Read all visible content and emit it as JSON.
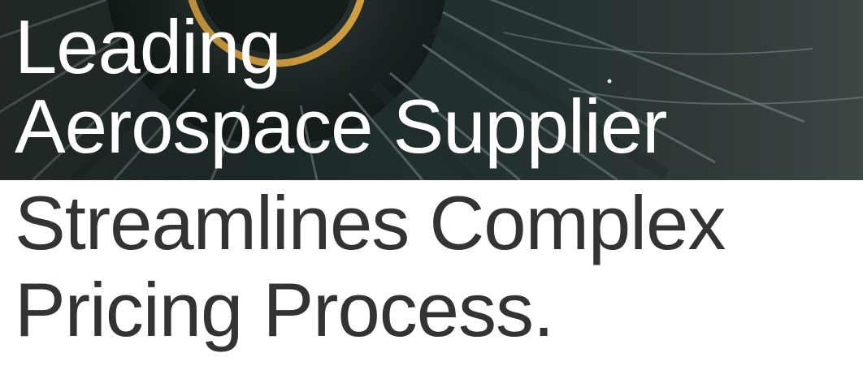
{
  "hero": {
    "image_name": "jet-engine-turbine-image",
    "accent_color": "#d9a441"
  },
  "headline": {
    "line1": "Leading",
    "line2": "Aerospace Supplier",
    "line3": "Streamlines Complex",
    "line4": "Pricing Process."
  },
  "colors": {
    "hero_text": "#ffffff",
    "body_text": "#333333",
    "background": "#ffffff"
  }
}
